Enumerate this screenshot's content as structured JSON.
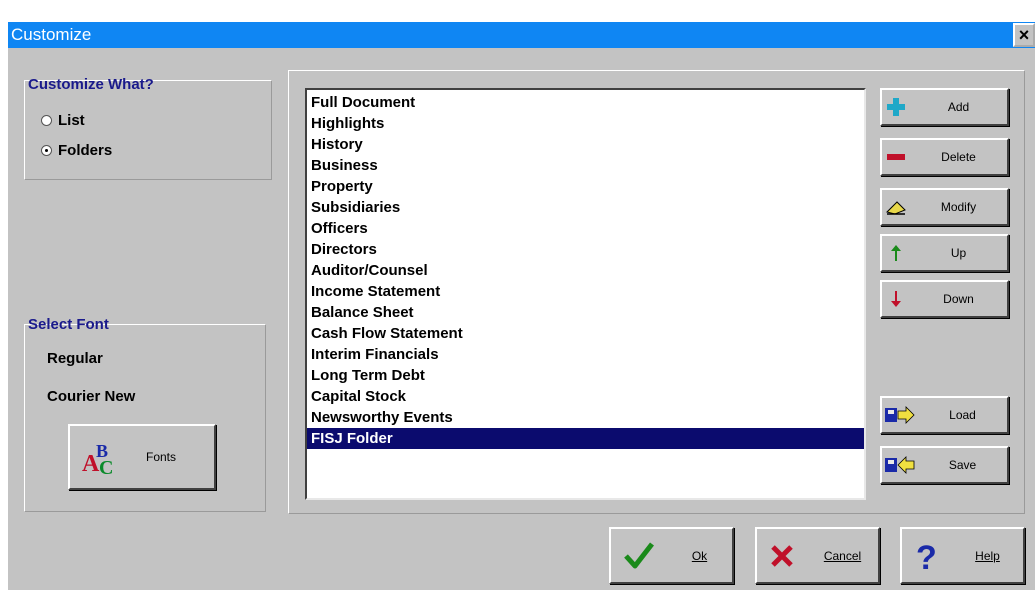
{
  "window": {
    "title": "Customize",
    "close_label": "×"
  },
  "customize_group": {
    "title": "Customize What?",
    "options": [
      {
        "label": "List",
        "checked": false
      },
      {
        "label": "Folders",
        "checked": true
      }
    ]
  },
  "font_group": {
    "title": "Select Font",
    "style": "Regular",
    "family": "Courier New",
    "fonts_button": "Fonts"
  },
  "list": {
    "items": [
      "Full Document",
      "Highlights",
      "History",
      "Business",
      "Property",
      "Subsidiaries",
      "Officers",
      "Directors",
      "Auditor/Counsel",
      "Income Statement",
      "Balance Sheet",
      "Cash Flow Statement",
      "Interim Financials",
      "Long Term Debt",
      "Capital Stock",
      "Newsworthy Events",
      "FISJ Folder"
    ],
    "selected": "FISJ Folder"
  },
  "side_buttons": {
    "add": "Add",
    "delete": "Delete",
    "modify": "Modify",
    "up": "Up",
    "down": "Down",
    "load": "Load",
    "save": "Save"
  },
  "bottom_buttons": {
    "ok": "Ok",
    "cancel": "Cancel",
    "help": "Help"
  },
  "colors": {
    "titlebar": "#0f86f3",
    "window_bg": "#c3c3c3",
    "group_title": "#1a1a8c",
    "selection": "#0b0b6e"
  }
}
